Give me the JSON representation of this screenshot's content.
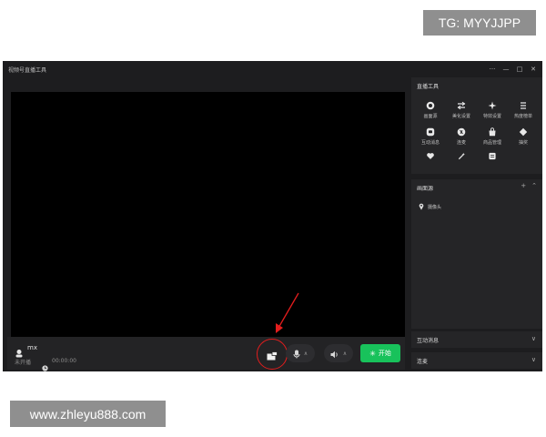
{
  "overlay": {
    "tg_label": "TG: MYYJJPP",
    "site_label": "www.zhleyu888.com"
  },
  "window": {
    "title": "视频号直播工具",
    "controls": [
      "···",
      "—",
      "□",
      "✕"
    ]
  },
  "bottom_bar": {
    "user_name": "mx",
    "status": "未开播",
    "timer": "00:00:00",
    "start_label": "开始"
  },
  "tools_panel": {
    "title": "直播工具",
    "items": [
      {
        "label": "画面源",
        "icon": "record-icon"
      },
      {
        "label": "美化设置",
        "icon": "sliders-icon"
      },
      {
        "label": "特效设置",
        "icon": "sparkle-icon"
      },
      {
        "label": "热度榜单",
        "icon": "list-icon"
      },
      {
        "label": "互动消息",
        "icon": "chat-icon"
      },
      {
        "label": "连麦",
        "icon": "link-icon"
      },
      {
        "label": "商品管理",
        "icon": "bag-icon"
      },
      {
        "label": "抽奖",
        "icon": "gift-icon"
      },
      {
        "label": "",
        "icon": "heart-icon"
      },
      {
        "label": "",
        "icon": "magic-icon"
      },
      {
        "label": "",
        "icon": "card-icon"
      }
    ]
  },
  "scene_panel": {
    "title": "画面源",
    "add": "+",
    "collapse": "⌃",
    "items": [
      {
        "label": "摄像头",
        "icon": "location-icon"
      }
    ]
  },
  "message_panel": {
    "title": "互动消息"
  },
  "chat_panel": {
    "title": "连麦"
  },
  "colors": {
    "start_green": "#18c25b",
    "highlight_red": "#e21d1d",
    "window_bg": "#1d1d1f"
  }
}
